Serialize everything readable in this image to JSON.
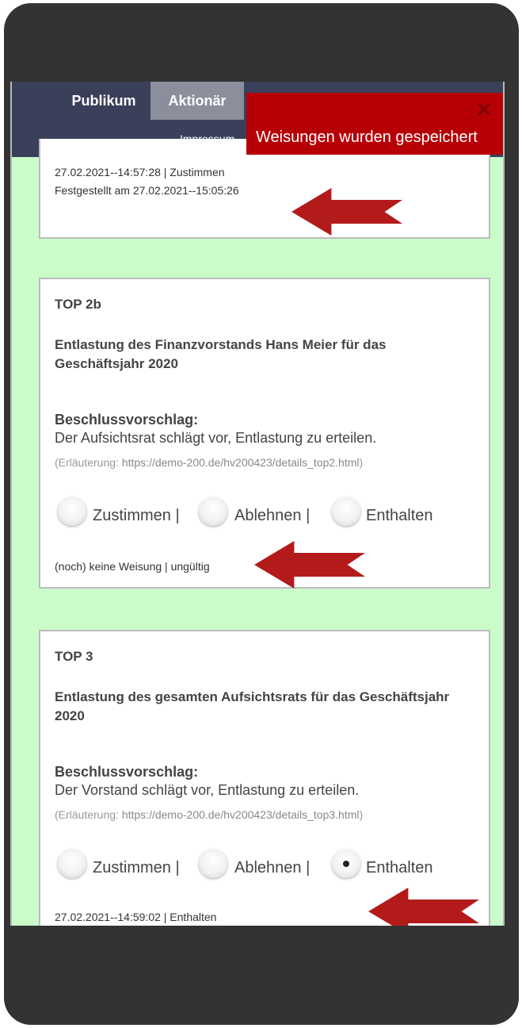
{
  "header": {
    "tabs": [
      {
        "label": "Publikum",
        "active": false
      },
      {
        "label": "Aktionär",
        "active": true
      }
    ],
    "impressum": "Impressum"
  },
  "toast": {
    "message": "Weisungen wurden gespeichert",
    "close": "✕",
    "color": "#b60006"
  },
  "cards": [
    {
      "status_line1": "27.02.2021--14:57:28 | Zustimmen",
      "status_line2": "Festgestellt am 27.02.2021--15:05:26"
    },
    {
      "top": "TOP 2b",
      "title": "Entlastung des Finanzvorstands Hans Meier für das Geschäftsjahr 2020",
      "bv_label": "Beschlussvorschlag:",
      "bv_text": "Der Aufsichtsrat schlägt vor, Entlastung zu erteilen.",
      "link_prefix": "(Erläuterung: ",
      "link_url": "https://demo-200.de/hv200423/details_top2.html",
      "link_suffix": ")",
      "options": [
        "Zustimmen |",
        "Ablehnen |",
        "Enthalten"
      ],
      "selected": null,
      "status": "(noch) keine Weisung | ungültig"
    },
    {
      "top": "TOP 3",
      "title": "Entlastung des gesamten Aufsichtsrats für das Geschäftsjahr 2020",
      "bv_label": "Beschlussvorschlag:",
      "bv_text": "Der Vorstand schlägt vor, Entlastung zu erteilen.",
      "link_prefix": "(Erläuterung: ",
      "link_url": "https://demo-200.de/hv200423/details_top3.html",
      "link_suffix": ")",
      "options": [
        "Zustimmen |",
        "Ablehnen |",
        "Enthalten"
      ],
      "selected": "Enthalten",
      "status": "27.02.2021--14:59:02 | Enthalten"
    }
  ],
  "colors": {
    "page_bg": "#c9fcc9",
    "header_bg": "#3a3f5a",
    "arrow": "#b31b1b"
  }
}
